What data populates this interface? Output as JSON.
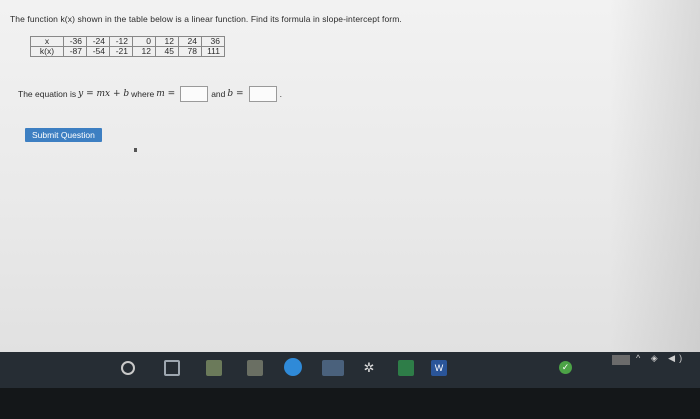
{
  "question": {
    "prompt": "The function k(x) shown in the table below is a linear function. Find its formula in slope-intercept form."
  },
  "table": {
    "rows": [
      {
        "header": "x",
        "values": [
          "-36",
          "-24",
          "-12",
          "0",
          "12",
          "24",
          "36"
        ]
      },
      {
        "header": "k(x)",
        "values": [
          "-87",
          "-54",
          "-21",
          "12",
          "45",
          "78",
          "111"
        ]
      }
    ]
  },
  "equation": {
    "prefix": "The equation is",
    "formula": "y = mx + b",
    "where_text": "where",
    "m_label": "m =",
    "and_text": "and",
    "b_label": "b =",
    "suffix": "."
  },
  "actions": {
    "submit_label": "Submit Question"
  },
  "taskbar": {
    "items": [
      "start-icon",
      "task-view-icon",
      "app-icon",
      "app-icon",
      "edge-browser-icon",
      "file-explorer-icon",
      "settings-gear-icon",
      "app-icon",
      "word-icon"
    ],
    "word_label": "W",
    "tray": {
      "check_label": "✓",
      "icons_text": "^ ◈ ◀)"
    }
  }
}
